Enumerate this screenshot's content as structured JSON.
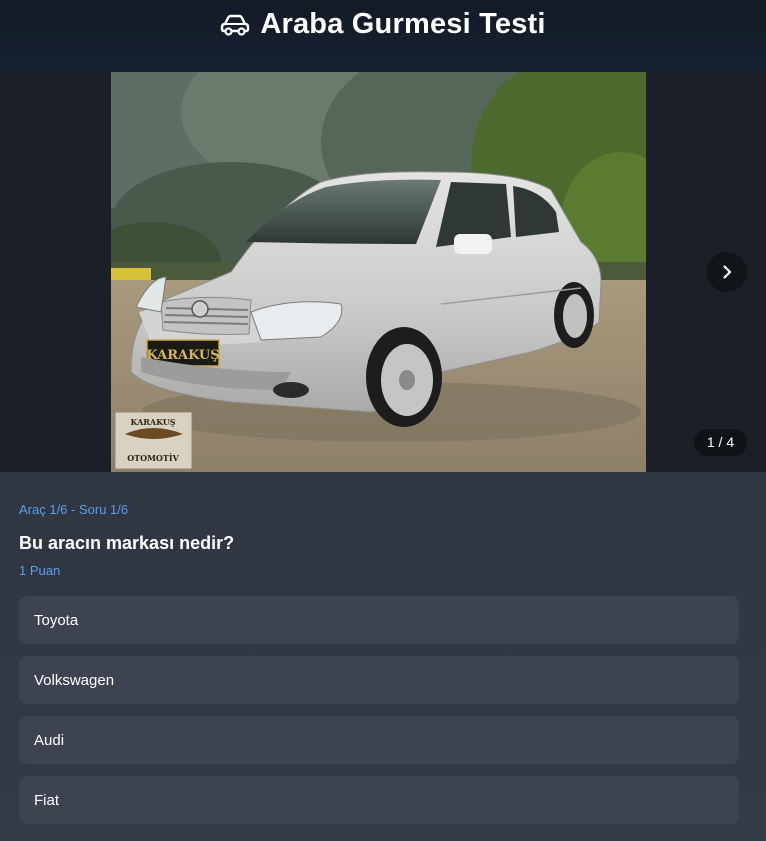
{
  "header": {
    "title": "Araba Gurmesi Testi",
    "icon": "car-icon"
  },
  "gallery": {
    "counter": "1 / 4",
    "next_icon": "chevron-right-icon",
    "photo": {
      "plate": "KARAKUŞ",
      "watermark_top": "KARAKUŞ",
      "watermark_bottom": "OTOMOTİV"
    }
  },
  "quiz": {
    "progress": "Araç 1/6 - Soru 1/6",
    "question": "Bu aracın markası nedir?",
    "points": "1 Puan",
    "options": [
      "Toyota",
      "Volkswagen",
      "Audi",
      "Fiat"
    ]
  },
  "colors": {
    "accent": "#5f9fe8",
    "header_bg": "#151d2a",
    "panel_bg": "#2f3541",
    "option_bg": "#3d4350"
  }
}
